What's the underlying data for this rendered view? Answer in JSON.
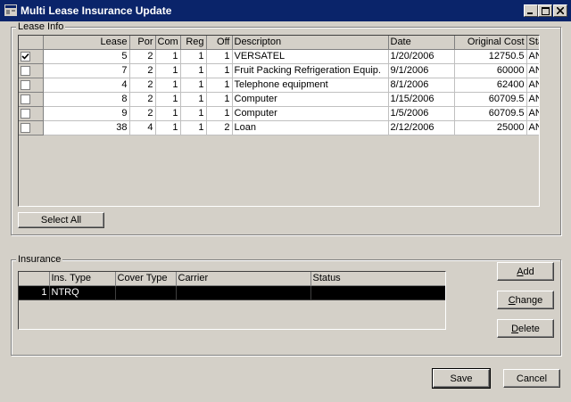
{
  "window": {
    "title": "Multi Lease Insurance Update"
  },
  "lease_info": {
    "label": "Lease Info",
    "columns": [
      "Lease",
      "Por",
      "Com",
      "Reg",
      "Off",
      "Descripton",
      "Date",
      "Original Cost",
      "Status"
    ],
    "rows": [
      {
        "checked": true,
        "lease": "5",
        "por": "2",
        "com": "1",
        "reg": "1",
        "off": "1",
        "desc": "VERSATEL",
        "date": "1/20/2006",
        "cost": "12750.5",
        "status": "ANOR"
      },
      {
        "checked": false,
        "lease": "7",
        "por": "2",
        "com": "1",
        "reg": "1",
        "off": "1",
        "desc": "Fruit Packing Refrigeration Equip.",
        "date": "9/1/2006",
        "cost": "60000",
        "status": "ANOR"
      },
      {
        "checked": false,
        "lease": "4",
        "por": "2",
        "com": "1",
        "reg": "1",
        "off": "1",
        "desc": "Telephone equipment",
        "date": "8/1/2006",
        "cost": "62400",
        "status": "ANOR"
      },
      {
        "checked": false,
        "lease": "8",
        "por": "2",
        "com": "1",
        "reg": "1",
        "off": "1",
        "desc": "Computer",
        "date": "1/15/2006",
        "cost": "60709.5",
        "status": "ANOR"
      },
      {
        "checked": false,
        "lease": "9",
        "por": "2",
        "com": "1",
        "reg": "1",
        "off": "1",
        "desc": "Computer",
        "date": "1/5/2006",
        "cost": "60709.5",
        "status": "ANOR"
      },
      {
        "checked": false,
        "lease": "38",
        "por": "4",
        "com": "1",
        "reg": "1",
        "off": "2",
        "desc": "Loan",
        "date": "2/12/2006",
        "cost": "25000",
        "status": "ANOR"
      }
    ],
    "select_all_label": "Select All"
  },
  "insurance": {
    "label": "Insurance",
    "columns": [
      "Ins. Type",
      "Cover Type",
      "Carrier",
      "Status"
    ],
    "rows": [
      {
        "num": "1",
        "ins_type": "NTRQ",
        "cover_type": "",
        "carrier": "",
        "status": ""
      }
    ],
    "add_label": "Add",
    "change_label": "Change",
    "delete_label": "Delete"
  },
  "footer": {
    "save_label": "Save",
    "cancel_label": "Cancel"
  },
  "colors": {
    "titlebar": "#0a246a",
    "face": "#d4d0c8",
    "selection": "#000000"
  },
  "icons": {
    "app": "window-app-icon",
    "minimize": "minimize-icon",
    "maximize": "maximize-icon",
    "close": "close-icon",
    "check": "checkmark-icon"
  }
}
